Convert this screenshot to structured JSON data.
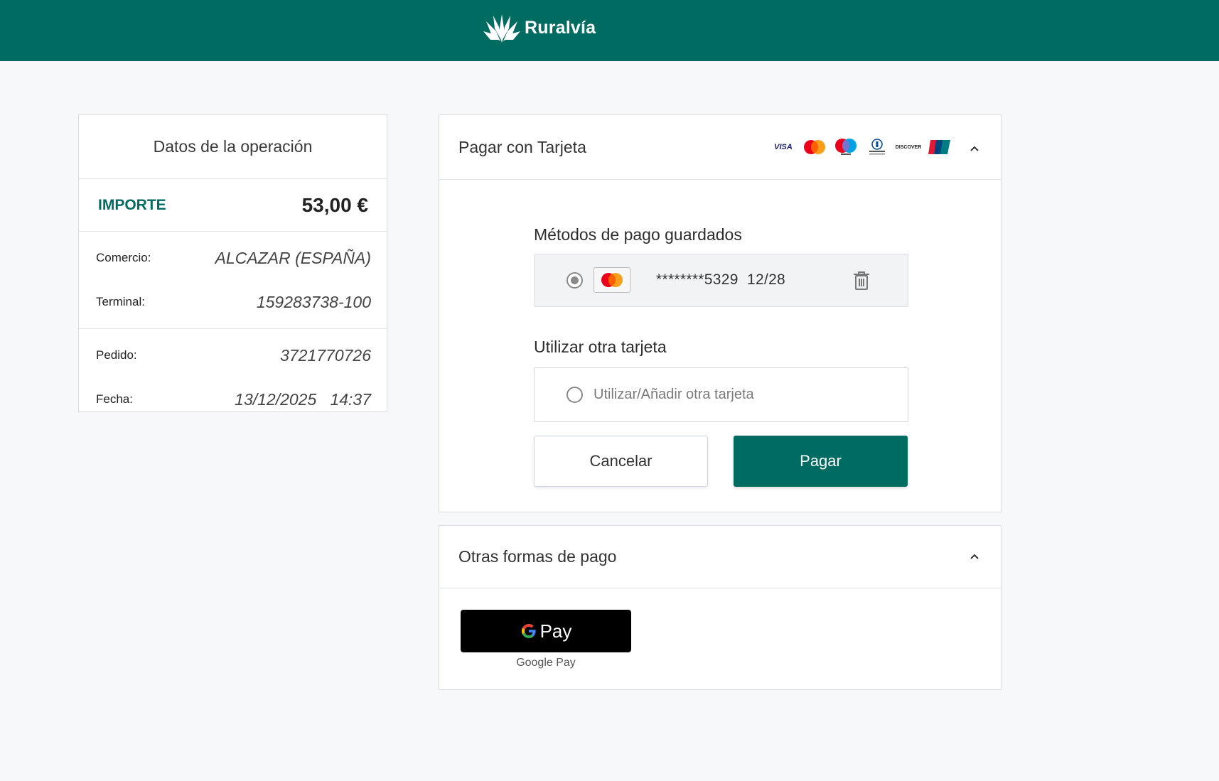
{
  "header": {
    "brand": "Ruralvía"
  },
  "operation": {
    "title": "Datos de la operación",
    "amount_label": "IMPORTE",
    "amount_value": "53,00 €",
    "rows": [
      {
        "key": "Comercio:",
        "value": "ALCAZAR (ESPAÑA)"
      },
      {
        "key": "Terminal:",
        "value": "159283738-100"
      },
      {
        "key": "Pedido:",
        "value": "3721770726"
      },
      {
        "key": "Fecha:",
        "value": "13/12/2025   14:37"
      }
    ]
  },
  "card_payment": {
    "title": "Pagar con Tarjeta",
    "brands": [
      "visa",
      "mastercard",
      "maestro",
      "diners-club",
      "discover",
      "unionpay"
    ],
    "brand_texts": {
      "visa": "VISA",
      "discover": "DISCOVER"
    },
    "saved_title": "Métodos de pago guardados",
    "saved_card": {
      "number": "********5329",
      "expiry": "12/28",
      "selected": true
    },
    "other_title": "Utilizar otra tarjeta",
    "other_label": "Utilizar/Añadir otra tarjeta",
    "cancel_label": "Cancelar",
    "pay_label": "Pagar"
  },
  "other_methods": {
    "title": "Otras formas de pago",
    "gpay_label": "Pay",
    "gpay_caption": "Google Pay"
  },
  "colors": {
    "primary": "#006b61",
    "background": "#f7f8f9"
  }
}
